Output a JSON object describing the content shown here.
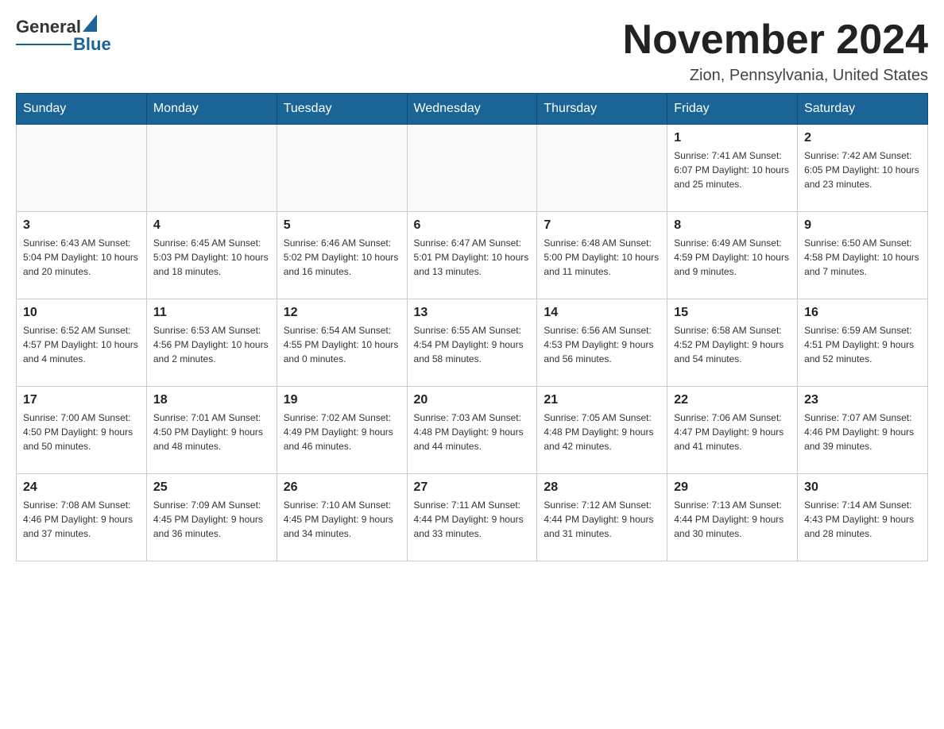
{
  "header": {
    "logo": {
      "general": "General",
      "blue": "Blue"
    },
    "title": "November 2024",
    "location": "Zion, Pennsylvania, United States"
  },
  "days_of_week": [
    "Sunday",
    "Monday",
    "Tuesday",
    "Wednesday",
    "Thursday",
    "Friday",
    "Saturday"
  ],
  "weeks": [
    [
      {
        "day": "",
        "info": ""
      },
      {
        "day": "",
        "info": ""
      },
      {
        "day": "",
        "info": ""
      },
      {
        "day": "",
        "info": ""
      },
      {
        "day": "",
        "info": ""
      },
      {
        "day": "1",
        "info": "Sunrise: 7:41 AM\nSunset: 6:07 PM\nDaylight: 10 hours and 25 minutes."
      },
      {
        "day": "2",
        "info": "Sunrise: 7:42 AM\nSunset: 6:05 PM\nDaylight: 10 hours and 23 minutes."
      }
    ],
    [
      {
        "day": "3",
        "info": "Sunrise: 6:43 AM\nSunset: 5:04 PM\nDaylight: 10 hours and 20 minutes."
      },
      {
        "day": "4",
        "info": "Sunrise: 6:45 AM\nSunset: 5:03 PM\nDaylight: 10 hours and 18 minutes."
      },
      {
        "day": "5",
        "info": "Sunrise: 6:46 AM\nSunset: 5:02 PM\nDaylight: 10 hours and 16 minutes."
      },
      {
        "day": "6",
        "info": "Sunrise: 6:47 AM\nSunset: 5:01 PM\nDaylight: 10 hours and 13 minutes."
      },
      {
        "day": "7",
        "info": "Sunrise: 6:48 AM\nSunset: 5:00 PM\nDaylight: 10 hours and 11 minutes."
      },
      {
        "day": "8",
        "info": "Sunrise: 6:49 AM\nSunset: 4:59 PM\nDaylight: 10 hours and 9 minutes."
      },
      {
        "day": "9",
        "info": "Sunrise: 6:50 AM\nSunset: 4:58 PM\nDaylight: 10 hours and 7 minutes."
      }
    ],
    [
      {
        "day": "10",
        "info": "Sunrise: 6:52 AM\nSunset: 4:57 PM\nDaylight: 10 hours and 4 minutes."
      },
      {
        "day": "11",
        "info": "Sunrise: 6:53 AM\nSunset: 4:56 PM\nDaylight: 10 hours and 2 minutes."
      },
      {
        "day": "12",
        "info": "Sunrise: 6:54 AM\nSunset: 4:55 PM\nDaylight: 10 hours and 0 minutes."
      },
      {
        "day": "13",
        "info": "Sunrise: 6:55 AM\nSunset: 4:54 PM\nDaylight: 9 hours and 58 minutes."
      },
      {
        "day": "14",
        "info": "Sunrise: 6:56 AM\nSunset: 4:53 PM\nDaylight: 9 hours and 56 minutes."
      },
      {
        "day": "15",
        "info": "Sunrise: 6:58 AM\nSunset: 4:52 PM\nDaylight: 9 hours and 54 minutes."
      },
      {
        "day": "16",
        "info": "Sunrise: 6:59 AM\nSunset: 4:51 PM\nDaylight: 9 hours and 52 minutes."
      }
    ],
    [
      {
        "day": "17",
        "info": "Sunrise: 7:00 AM\nSunset: 4:50 PM\nDaylight: 9 hours and 50 minutes."
      },
      {
        "day": "18",
        "info": "Sunrise: 7:01 AM\nSunset: 4:50 PM\nDaylight: 9 hours and 48 minutes."
      },
      {
        "day": "19",
        "info": "Sunrise: 7:02 AM\nSunset: 4:49 PM\nDaylight: 9 hours and 46 minutes."
      },
      {
        "day": "20",
        "info": "Sunrise: 7:03 AM\nSunset: 4:48 PM\nDaylight: 9 hours and 44 minutes."
      },
      {
        "day": "21",
        "info": "Sunrise: 7:05 AM\nSunset: 4:48 PM\nDaylight: 9 hours and 42 minutes."
      },
      {
        "day": "22",
        "info": "Sunrise: 7:06 AM\nSunset: 4:47 PM\nDaylight: 9 hours and 41 minutes."
      },
      {
        "day": "23",
        "info": "Sunrise: 7:07 AM\nSunset: 4:46 PM\nDaylight: 9 hours and 39 minutes."
      }
    ],
    [
      {
        "day": "24",
        "info": "Sunrise: 7:08 AM\nSunset: 4:46 PM\nDaylight: 9 hours and 37 minutes."
      },
      {
        "day": "25",
        "info": "Sunrise: 7:09 AM\nSunset: 4:45 PM\nDaylight: 9 hours and 36 minutes."
      },
      {
        "day": "26",
        "info": "Sunrise: 7:10 AM\nSunset: 4:45 PM\nDaylight: 9 hours and 34 minutes."
      },
      {
        "day": "27",
        "info": "Sunrise: 7:11 AM\nSunset: 4:44 PM\nDaylight: 9 hours and 33 minutes."
      },
      {
        "day": "28",
        "info": "Sunrise: 7:12 AM\nSunset: 4:44 PM\nDaylight: 9 hours and 31 minutes."
      },
      {
        "day": "29",
        "info": "Sunrise: 7:13 AM\nSunset: 4:44 PM\nDaylight: 9 hours and 30 minutes."
      },
      {
        "day": "30",
        "info": "Sunrise: 7:14 AM\nSunset: 4:43 PM\nDaylight: 9 hours and 28 minutes."
      }
    ]
  ],
  "colors": {
    "header_bg": "#1a6496",
    "header_text": "#ffffff",
    "border": "#cccccc",
    "day_number": "#222222",
    "day_info": "#333333"
  }
}
